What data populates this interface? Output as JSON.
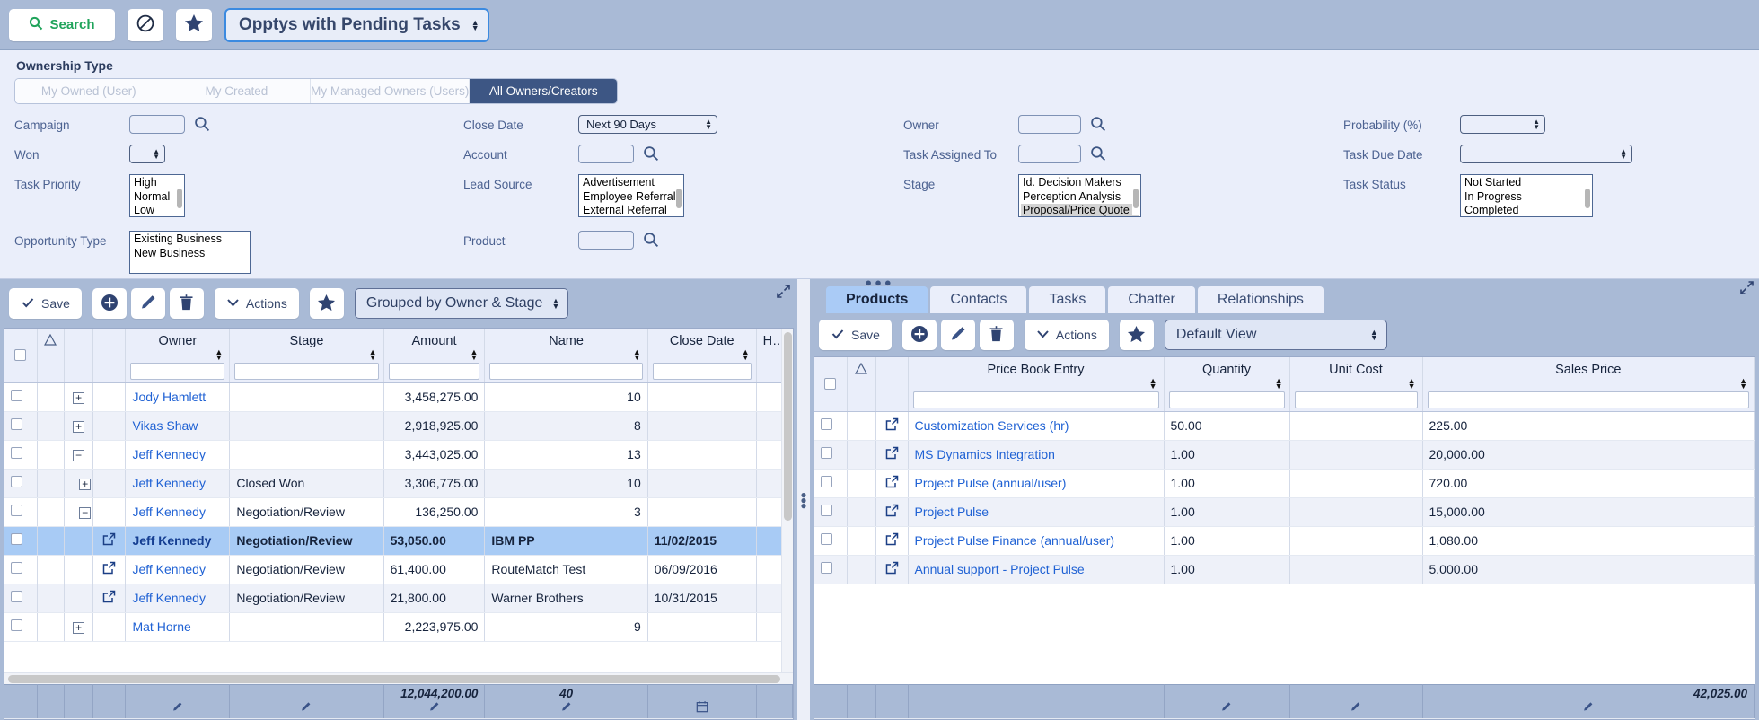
{
  "toolbar": {
    "search_label": "Search",
    "block_icon": "no-entry-icon",
    "star_icon": "star-icon",
    "view_select_value": "Opptys with Pending Tasks"
  },
  "filters": {
    "ownership_label": "Ownership Type",
    "ownership_tabs": [
      {
        "label": "My Owned (User)",
        "active": false
      },
      {
        "label": "My Created",
        "active": false
      },
      {
        "label": "My Managed Owners (Users)",
        "active": false
      },
      {
        "label": "All Owners/Creators",
        "active": true
      }
    ],
    "col1": [
      {
        "label": "Campaign",
        "type": "text",
        "value": "",
        "lookup": true
      },
      {
        "label": "Won",
        "type": "select",
        "value": ""
      },
      {
        "label": "Task Priority",
        "type": "list",
        "options": [
          "High",
          "Normal",
          "Low"
        ],
        "selected": []
      },
      {
        "label": "Opportunity Type",
        "type": "list",
        "options": [
          "Existing Business",
          "New Business"
        ],
        "selected": []
      }
    ],
    "col2": [
      {
        "label": "Close Date",
        "type": "select",
        "value": "Next 90 Days"
      },
      {
        "label": "Account",
        "type": "text",
        "value": "",
        "lookup": true
      },
      {
        "label": "Lead Source",
        "type": "list",
        "options": [
          "Advertisement",
          "Employee Referral",
          "External Referral"
        ],
        "selected": []
      },
      {
        "label": "Product",
        "type": "text",
        "value": "",
        "lookup": true
      }
    ],
    "col3": [
      {
        "label": "Owner",
        "type": "text",
        "value": "",
        "lookup": true
      },
      {
        "label": "Task Assigned To",
        "type": "text",
        "value": "",
        "lookup": true
      },
      {
        "label": "Stage",
        "type": "list",
        "options": [
          "Id. Decision Makers",
          "Perception Analysis",
          "Proposal/Price Quote"
        ],
        "selected": [
          "Proposal/Price Quote"
        ]
      }
    ],
    "col4": [
      {
        "label": "Probability (%)",
        "type": "select",
        "value": ""
      },
      {
        "label": "Task Due Date",
        "type": "select",
        "value": ""
      },
      {
        "label": "Task Status",
        "type": "list",
        "options": [
          "Not Started",
          "In Progress",
          "Completed"
        ],
        "selected": []
      }
    ]
  },
  "left_panel": {
    "toolbar": {
      "save_label": "Save",
      "add_icon": "plus-circle-icon",
      "edit_icon": "pencil-icon",
      "delete_icon": "trash-icon",
      "actions_label": "Actions",
      "favorite_icon": "star-icon",
      "view_select_value": "Grouped by Owner & Stage",
      "collapse_icon": "collapse-icon"
    },
    "columns": [
      "",
      "",
      "",
      "",
      "Owner",
      "Stage",
      "Amount",
      "Name",
      "Close Date",
      "Has"
    ],
    "rows": [
      {
        "expander": "+",
        "open": false,
        "owner": "Jody Hamlett",
        "stage": "",
        "amount": "3,458,275.00",
        "name": "10",
        "close_date": "",
        "selected": false
      },
      {
        "expander": "+",
        "open": false,
        "owner": "Vikas Shaw",
        "stage": "",
        "amount": "2,918,925.00",
        "name": "8",
        "close_date": "",
        "selected": false
      },
      {
        "expander": "−",
        "open": false,
        "owner": "Jeff Kennedy",
        "stage": "",
        "amount": "3,443,025.00",
        "name": "13",
        "close_date": "",
        "selected": false
      },
      {
        "expander": "+",
        "indent": 1,
        "open": false,
        "owner": "Jeff Kennedy",
        "stage": "Closed Won",
        "amount": "3,306,775.00",
        "name": "10",
        "close_date": "",
        "selected": false
      },
      {
        "expander": "−",
        "indent": 1,
        "open": false,
        "owner": "Jeff Kennedy",
        "stage": "Negotiation/Review",
        "amount": "136,250.00",
        "name": "3",
        "close_date": "",
        "selected": false
      },
      {
        "expander": "",
        "open": true,
        "owner": "Jeff Kennedy",
        "stage": "Negotiation/Review",
        "amount": "53,050.00",
        "name": "IBM PP",
        "close_date": "11/02/2015",
        "selected": true
      },
      {
        "expander": "",
        "open": true,
        "owner": "Jeff Kennedy",
        "stage": "Negotiation/Review",
        "amount": "61,400.00",
        "name": "RouteMatch Test",
        "close_date": "06/09/2016",
        "selected": false
      },
      {
        "expander": "",
        "open": true,
        "owner": "Jeff Kennedy",
        "stage": "Negotiation/Review",
        "amount": "21,800.00",
        "name": "Warner Brothers",
        "close_date": "10/31/2015",
        "selected": false
      },
      {
        "expander": "+",
        "open": false,
        "owner": "Mat Horne",
        "stage": "",
        "amount": "2,223,975.00",
        "name": "9",
        "close_date": "",
        "selected": false
      }
    ],
    "footer": {
      "amount_total": "12,044,200.00",
      "name_total": "40"
    }
  },
  "right_panel": {
    "collapse_icon": "collapse-icon",
    "tabs": [
      {
        "label": "Products",
        "active": true
      },
      {
        "label": "Contacts",
        "active": false
      },
      {
        "label": "Tasks",
        "active": false
      },
      {
        "label": "Chatter",
        "active": false
      },
      {
        "label": "Relationships",
        "active": false
      }
    ],
    "toolbar": {
      "save_label": "Save",
      "add_icon": "plus-circle-icon",
      "edit_icon": "pencil-icon",
      "delete_icon": "trash-icon",
      "actions_label": "Actions",
      "favorite_icon": "star-icon",
      "view_select_value": "Default View"
    },
    "columns": [
      "",
      "",
      "",
      "Price Book Entry",
      "Quantity",
      "Unit Cost",
      "Sales Price"
    ],
    "rows": [
      {
        "price_book_entry": "Customization Services (hr)",
        "quantity": "50.00",
        "unit_cost": "",
        "sales_price": "225.00"
      },
      {
        "price_book_entry": "MS Dynamics Integration",
        "quantity": "1.00",
        "unit_cost": "",
        "sales_price": "20,000.00"
      },
      {
        "price_book_entry": "Project Pulse (annual/user)",
        "quantity": "1.00",
        "unit_cost": "",
        "sales_price": "720.00"
      },
      {
        "price_book_entry": "Project Pulse",
        "quantity": "1.00",
        "unit_cost": "",
        "sales_price": "15,000.00"
      },
      {
        "price_book_entry": "Project Pulse Finance (annual/user)",
        "quantity": "1.00",
        "unit_cost": "",
        "sales_price": "1,080.00"
      },
      {
        "price_book_entry": "Annual support - Project Pulse",
        "quantity": "1.00",
        "unit_cost": "",
        "sales_price": "5,000.00"
      }
    ],
    "footer": {
      "sales_price_total": "42,025.00"
    }
  },
  "colors": {
    "toolbar_bg": "#a9bad6",
    "panel_bg": "#eaeefa",
    "accent_blue": "#3b8ae0",
    "link": "#2062d4",
    "selected_row": "#a8cbf5",
    "active_tab": "#3d5684",
    "search_green": "#20a45b"
  }
}
